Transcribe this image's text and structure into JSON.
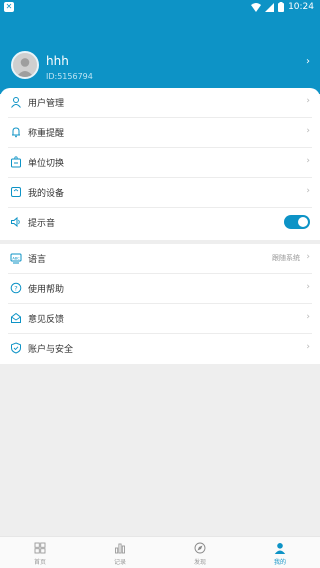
{
  "status_bar": {
    "time": "10:24"
  },
  "profile": {
    "username": "hhh",
    "user_id": "ID:5156794"
  },
  "menu_group1": [
    {
      "label": "用户管理",
      "icon": "user-icon"
    },
    {
      "label": "称重提醒",
      "icon": "bell-icon"
    },
    {
      "label": "单位切换",
      "icon": "scale-icon"
    },
    {
      "label": "我的设备",
      "icon": "device-icon"
    },
    {
      "label": "提示音",
      "icon": "speaker-icon",
      "toggle": true
    }
  ],
  "menu_group2": [
    {
      "label": "语言",
      "icon": "language-icon",
      "value": "跟随系统"
    },
    {
      "label": "使用帮助",
      "icon": "help-icon"
    },
    {
      "label": "意见反馈",
      "icon": "feedback-icon"
    },
    {
      "label": "账户与安全",
      "icon": "shield-icon"
    }
  ],
  "tabbar": [
    {
      "label": "首页",
      "icon": "home-grid-icon"
    },
    {
      "label": "记录",
      "icon": "chart-icon"
    },
    {
      "label": "发现",
      "icon": "compass-icon"
    },
    {
      "label": "我的",
      "icon": "person-icon",
      "active": true
    }
  ],
  "colors": {
    "accent": "#0d93c6",
    "background": "#eeeeee"
  }
}
